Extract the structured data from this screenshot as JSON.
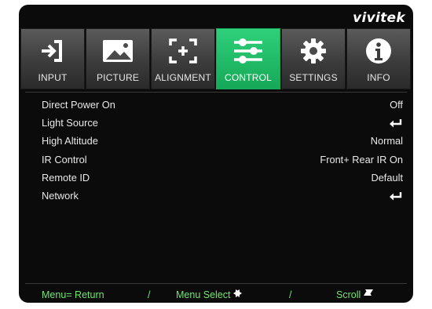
{
  "brand": "vivitek",
  "tabs": [
    {
      "label": "INPUT",
      "icon": "input-icon",
      "active": false
    },
    {
      "label": "PICTURE",
      "icon": "picture-icon",
      "active": false
    },
    {
      "label": "ALIGNMENT",
      "icon": "alignment-icon",
      "active": false
    },
    {
      "label": "CONTROL",
      "icon": "control-sliders-icon",
      "active": true
    },
    {
      "label": "SETTINGS",
      "icon": "gear-icon",
      "active": false
    },
    {
      "label": "INFO",
      "icon": "info-icon",
      "active": false
    }
  ],
  "menu": [
    {
      "label": "Direct Power On",
      "value": "Off"
    },
    {
      "label": "Light Source",
      "value": "",
      "enter": true
    },
    {
      "label": "High Altitude",
      "value": "Normal"
    },
    {
      "label": "IR Control",
      "value": "Front+ Rear IR On"
    },
    {
      "label": "Remote ID",
      "value": "Default"
    },
    {
      "label": "Network",
      "value": "",
      "enter": true
    }
  ],
  "footer": {
    "return": "Menu= Return",
    "slash1": "/",
    "select": "Menu Select",
    "slash2": "/",
    "scroll": "Scroll"
  },
  "colors": {
    "active_tab": "#1fbf66",
    "footer_text": "#6fe66f"
  }
}
